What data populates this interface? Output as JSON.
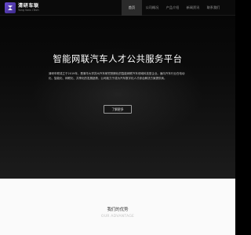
{
  "logo": {
    "name_cn": "清研车联",
    "name_en": "Tsing Vans I-Tech",
    "icon": "logo-mark-icon",
    "brand_color": "#5a3fc0"
  },
  "nav": {
    "items": [
      {
        "label": "首页",
        "active": true
      },
      {
        "label": "公司概况",
        "active": false
      },
      {
        "label": "产品介绍",
        "active": false
      },
      {
        "label": "新闻资讯",
        "active": false
      },
      {
        "label": "联系我们",
        "active": false
      }
    ]
  },
  "hero": {
    "title": "智能网联汽车人才公共服务平台",
    "description": "清研车联成立于2019年，是清华大学苏州汽车研究院孵化的智能网联汽车领域科技型企业。面向汽车行业在电动化、智能化、网联化、共享化的发展趋势，公司致力于成为汽车数字化人才综合解决方案提供商。",
    "cta_label": "了解更多"
  },
  "advantage": {
    "title": "我们的优势",
    "subtitle": "OUR ADVANTAGE"
  }
}
